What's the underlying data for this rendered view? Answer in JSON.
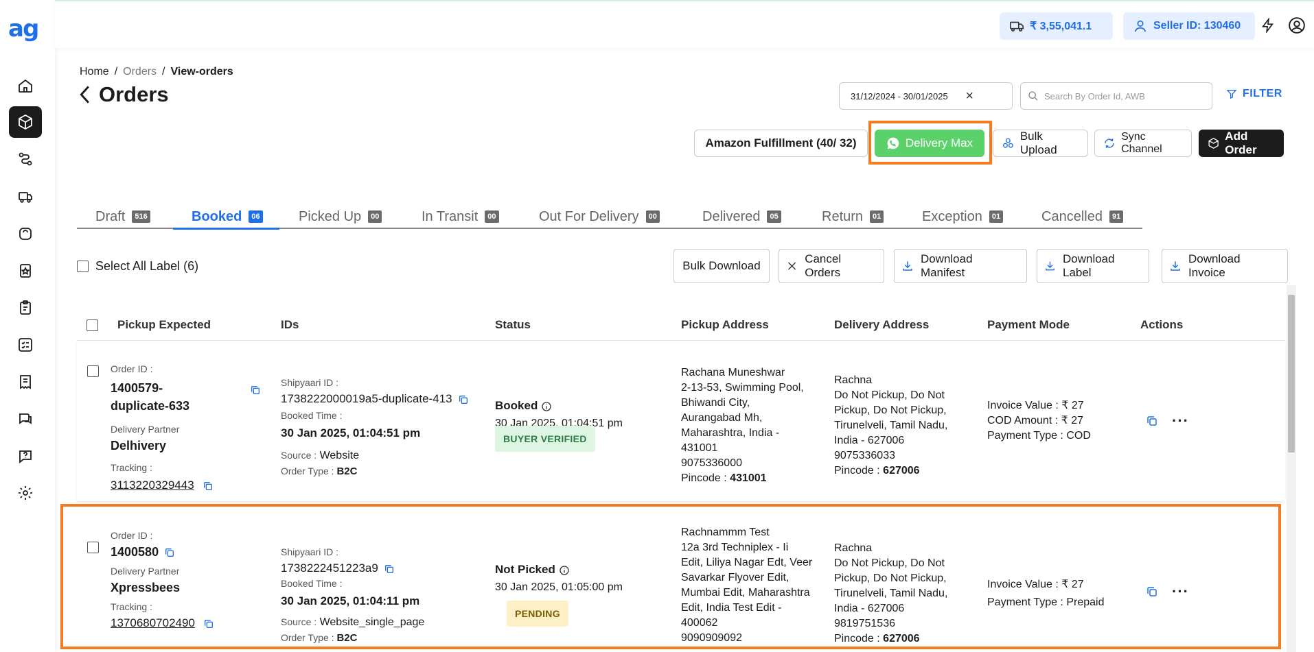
{
  "app": {
    "logo": "ag"
  },
  "topbar": {
    "wallet": "₹ 3,55,041.1",
    "seller": "Seller ID: 130460"
  },
  "breadcrumb": [
    "Home",
    "Orders",
    "View-orders"
  ],
  "breadcrumb_sep": "/",
  "page_title": "Orders",
  "filters": {
    "date_range": "31/12/2024 - 30/01/2025",
    "search_placeholder": "Search By Order Id, AWB",
    "filter_label": "FILTER"
  },
  "header_buttons": {
    "amazon": "Amazon Fulfillment (40/ 32)",
    "delivery_max": "Delivery Max",
    "bulk_upload": "Bulk Upload",
    "sync_channel": "Sync Channel",
    "add_order": "Add Order"
  },
  "tabs": [
    {
      "label": "Draft",
      "count": "516"
    },
    {
      "label": "Booked",
      "count": "06"
    },
    {
      "label": "Picked Up",
      "count": "00"
    },
    {
      "label": "In Transit",
      "count": "00"
    },
    {
      "label": "Out For Delivery",
      "count": "00"
    },
    {
      "label": "Delivered",
      "count": "05"
    },
    {
      "label": "Return",
      "count": "01"
    },
    {
      "label": "Exception",
      "count": "01"
    },
    {
      "label": "Cancelled",
      "count": "91"
    }
  ],
  "actions": {
    "select_all": "Select All Label (6)",
    "bulk_download": "Bulk Download",
    "cancel_orders": "Cancel Orders",
    "download_manifest": "Download Manifest",
    "download_label": "Download Label",
    "download_invoice": "Download Invoice"
  },
  "columns": [
    "Pickup Expected",
    "IDs",
    "Status",
    "Pickup Address",
    "Delivery Address",
    "Payment Mode",
    "Actions"
  ],
  "labels": {
    "order_id": "Order ID :",
    "delivery_partner": "Delivery Partner",
    "tracking": "Tracking :",
    "shipyaari_id": "Shipyaari ID :",
    "booked_time": "Booked Time :",
    "source": "Source :",
    "order_type": "Order Type :",
    "pincode": "Pincode :"
  },
  "rows": [
    {
      "order_id": "1400579-duplicate-633",
      "partner": "Delhivery",
      "tracking": "3113220329443",
      "shipyaari_id": "1738222000019a5-duplicate-413",
      "booked_time": "30 Jan 2025, 01:04:51 pm",
      "source": "Website",
      "order_type": "B2C",
      "status": "Booked",
      "status_time": "30 Jan 2025, 01:04:51 pm",
      "badge": "BUYER VERIFIED",
      "pickup_lines": [
        "Rachana Muneshwar",
        "2-13-53, Swimming Pool,",
        "Bhiwandi City,",
        "Aurangabad Mh,",
        "Maharashtra, India -",
        "431001",
        "9075336000"
      ],
      "pickup_pincode": "431001",
      "delivery_lines": [
        "Rachna",
        "Do Not Pickup, Do Not",
        "Pickup, Do Not Pickup,",
        "Tirunelveli, Tamil Nadu,",
        "India - 627006",
        "9075336033"
      ],
      "delivery_pincode": "627006",
      "payment_lines": [
        "Invoice Value : ₹ 27",
        "COD Amount : ₹ 27",
        "Payment Type : COD"
      ]
    },
    {
      "order_id": "1400580",
      "partner": "Xpressbees",
      "tracking": "1370680702490",
      "shipyaari_id": "1738222451223a9",
      "booked_time": "30 Jan 2025, 01:04:11 pm",
      "source": "Website_single_page",
      "order_type": "B2C",
      "status": "Not Picked",
      "status_time": "30 Jan 2025, 01:05:00 pm",
      "badge": "PENDING",
      "pickup_lines": [
        "Rachnammm Test",
        "12a 3rd Techniplex - Ii",
        "Edit, Liliya Nagar Edt, Veer",
        "Savarkar Flyover Edit,",
        "Mumbai Edit, Maharashtra",
        "Edit, India Test Edit -",
        "400062",
        "9090909092"
      ],
      "delivery_lines": [
        "Rachna",
        "Do Not Pickup, Do Not",
        "Pickup, Do Not Pickup,",
        "Tirunelveli, Tamil Nadu,",
        "India - 627006",
        "9819751536"
      ],
      "delivery_pincode": "627006",
      "payment_lines": [
        "Invoice Value : ₹ 27",
        "Payment Type : Prepaid"
      ]
    }
  ],
  "row_actions": {
    "more": "···"
  },
  "colors": {
    "accent": "#1f6fe6",
    "highlight": "#f47b20",
    "green": "#5bd16a"
  }
}
